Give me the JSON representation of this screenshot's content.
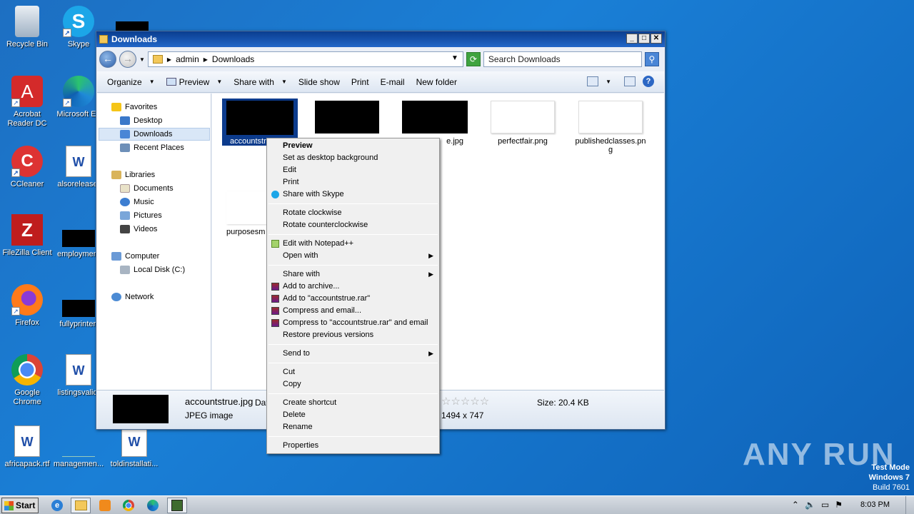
{
  "desktop": {
    "icons": [
      {
        "label": "Recycle Bin"
      },
      {
        "label": "Skype"
      },
      {
        "label": "Acrobat Reader DC"
      },
      {
        "label": "Microsoft Ed"
      },
      {
        "label": "CCleaner"
      },
      {
        "label": "alsorelease."
      },
      {
        "label": "FileZilla Client"
      },
      {
        "label": "employment"
      },
      {
        "label": "Firefox"
      },
      {
        "label": "fullyprinter."
      },
      {
        "label": "Google Chrome"
      },
      {
        "label": "listingsvalid."
      },
      {
        "label": "africapack.rtf"
      },
      {
        "label": "managemen..."
      },
      {
        "label": "toldinstallati..."
      }
    ]
  },
  "window": {
    "title": "Downloads",
    "controls": {
      "minimize": "_",
      "maximize": "□",
      "close": "✕"
    },
    "breadcrumb": [
      "admin",
      "Downloads"
    ],
    "search_placeholder": "Search Downloads",
    "toolbar": {
      "organize": "Organize",
      "preview": "Preview",
      "share_with": "Share with",
      "slide_show": "Slide show",
      "print": "Print",
      "email": "E-mail",
      "new_folder": "New folder"
    },
    "nav": {
      "favorites": "Favorites",
      "desktop": "Desktop",
      "downloads": "Downloads",
      "recent_places": "Recent Places",
      "libraries": "Libraries",
      "documents": "Documents",
      "music": "Music",
      "pictures": "Pictures",
      "videos": "Videos",
      "computer": "Computer",
      "local_disk": "Local Disk (C:)",
      "network": "Network"
    },
    "files": [
      {
        "name": "accountstr"
      },
      {
        "name": ""
      },
      {
        "name": "e.jpg"
      },
      {
        "name": "perfectfair.png"
      },
      {
        "name": "publishedclasses.png"
      },
      {
        "name": "purposesm"
      }
    ],
    "details": {
      "filename": "accountstrue.jpg",
      "date_label": "Dat",
      "type": "JPEG image",
      "dimensions": "1494 x 747",
      "size": "Size: 20.4 KB"
    }
  },
  "context_menu": {
    "items": {
      "preview": "Preview",
      "desktop_bg": "Set as desktop background",
      "edit": "Edit",
      "print": "Print",
      "share_skype": "Share with Skype",
      "rotate_cw": "Rotate clockwise",
      "rotate_ccw": "Rotate counterclockwise",
      "edit_npp": "Edit with Notepad++",
      "open_with": "Open with",
      "share_with": "Share with",
      "add_archive": "Add to archive...",
      "add_rar": "Add to \"accountstrue.rar\"",
      "compress_email": "Compress and email...",
      "compress_rar_email": "Compress to \"accountstrue.rar\" and email",
      "restore": "Restore previous versions",
      "send_to": "Send to",
      "cut": "Cut",
      "copy": "Copy",
      "create_shortcut": "Create shortcut",
      "delete": "Delete",
      "rename": "Rename",
      "properties": "Properties"
    },
    "submenu_arrow": "▶"
  },
  "taskbar": {
    "start_label": "Start",
    "clock": "8:03 PM"
  },
  "watermark": "ANY RUN",
  "testmode": {
    "line1": "Test Mode",
    "line2": "Windows 7",
    "line3": "Build 7601"
  }
}
